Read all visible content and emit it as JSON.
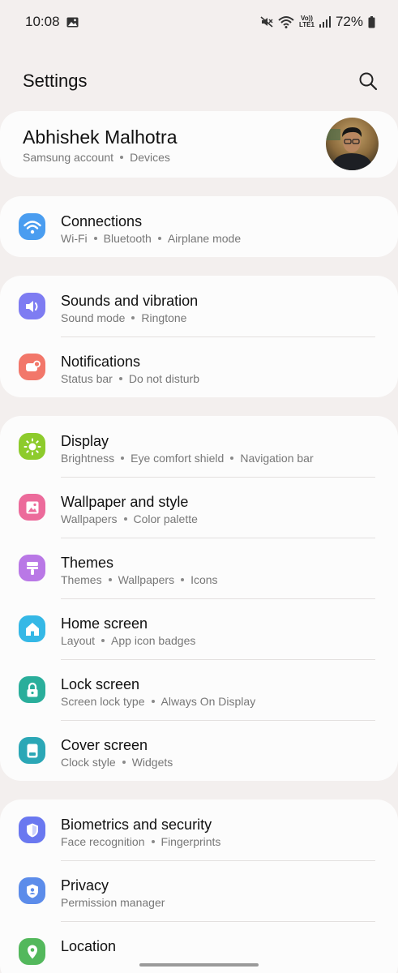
{
  "status_bar": {
    "time": "10:08",
    "network_label_top": "Vo))",
    "network_label_bottom": "LTE1",
    "battery": "72%"
  },
  "header": {
    "title": "Settings",
    "search_icon": "search-icon"
  },
  "account": {
    "name": "Abhishek Malhotra",
    "sub_1": "Samsung account",
    "sub_2": "Devices"
  },
  "groups": {
    "connections": {
      "title": "Connections",
      "icon": "wifi-icon",
      "color": "#4a9df0",
      "subs": [
        "Wi-Fi",
        "Bluetooth",
        "Airplane mode"
      ]
    },
    "sounds": {
      "title": "Sounds and vibration",
      "icon": "speaker-icon",
      "color": "#7e7cf2",
      "subs": [
        "Sound mode",
        "Ringtone"
      ]
    },
    "notifications": {
      "title": "Notifications",
      "icon": "notification-icon",
      "color": "#f2776a",
      "subs": [
        "Status bar",
        "Do not disturb"
      ]
    },
    "display": {
      "title": "Display",
      "icon": "sun-icon",
      "color": "#8dcb2c",
      "subs": [
        "Brightness",
        "Eye comfort shield",
        "Navigation bar"
      ]
    },
    "wallpaper": {
      "title": "Wallpaper and style",
      "icon": "image-icon",
      "color": "#ec6b9b",
      "subs": [
        "Wallpapers",
        "Color palette"
      ]
    },
    "themes": {
      "title": "Themes",
      "icon": "brush-icon",
      "color": "#b978e6",
      "subs": [
        "Themes",
        "Wallpapers",
        "Icons"
      ]
    },
    "home": {
      "title": "Home screen",
      "icon": "home-icon",
      "color": "#35b8e6",
      "subs": [
        "Layout",
        "App icon badges"
      ]
    },
    "lock": {
      "title": "Lock screen",
      "icon": "lock-icon",
      "color": "#2aae9b",
      "subs": [
        "Screen lock type",
        "Always On Display"
      ]
    },
    "cover": {
      "title": "Cover screen",
      "icon": "cover-screen-icon",
      "color": "#2ba7b6",
      "subs": [
        "Clock style",
        "Widgets"
      ]
    },
    "biometrics": {
      "title": "Biometrics and security",
      "icon": "shield-icon",
      "color": "#6a78f0",
      "subs": [
        "Face recognition",
        "Fingerprints"
      ]
    },
    "privacy": {
      "title": "Privacy",
      "icon": "privacy-icon",
      "color": "#5c8cea",
      "subs": [
        "Permission manager"
      ]
    },
    "location": {
      "title": "Location",
      "icon": "location-pin-icon",
      "color": "#53b85c",
      "subs": []
    }
  }
}
